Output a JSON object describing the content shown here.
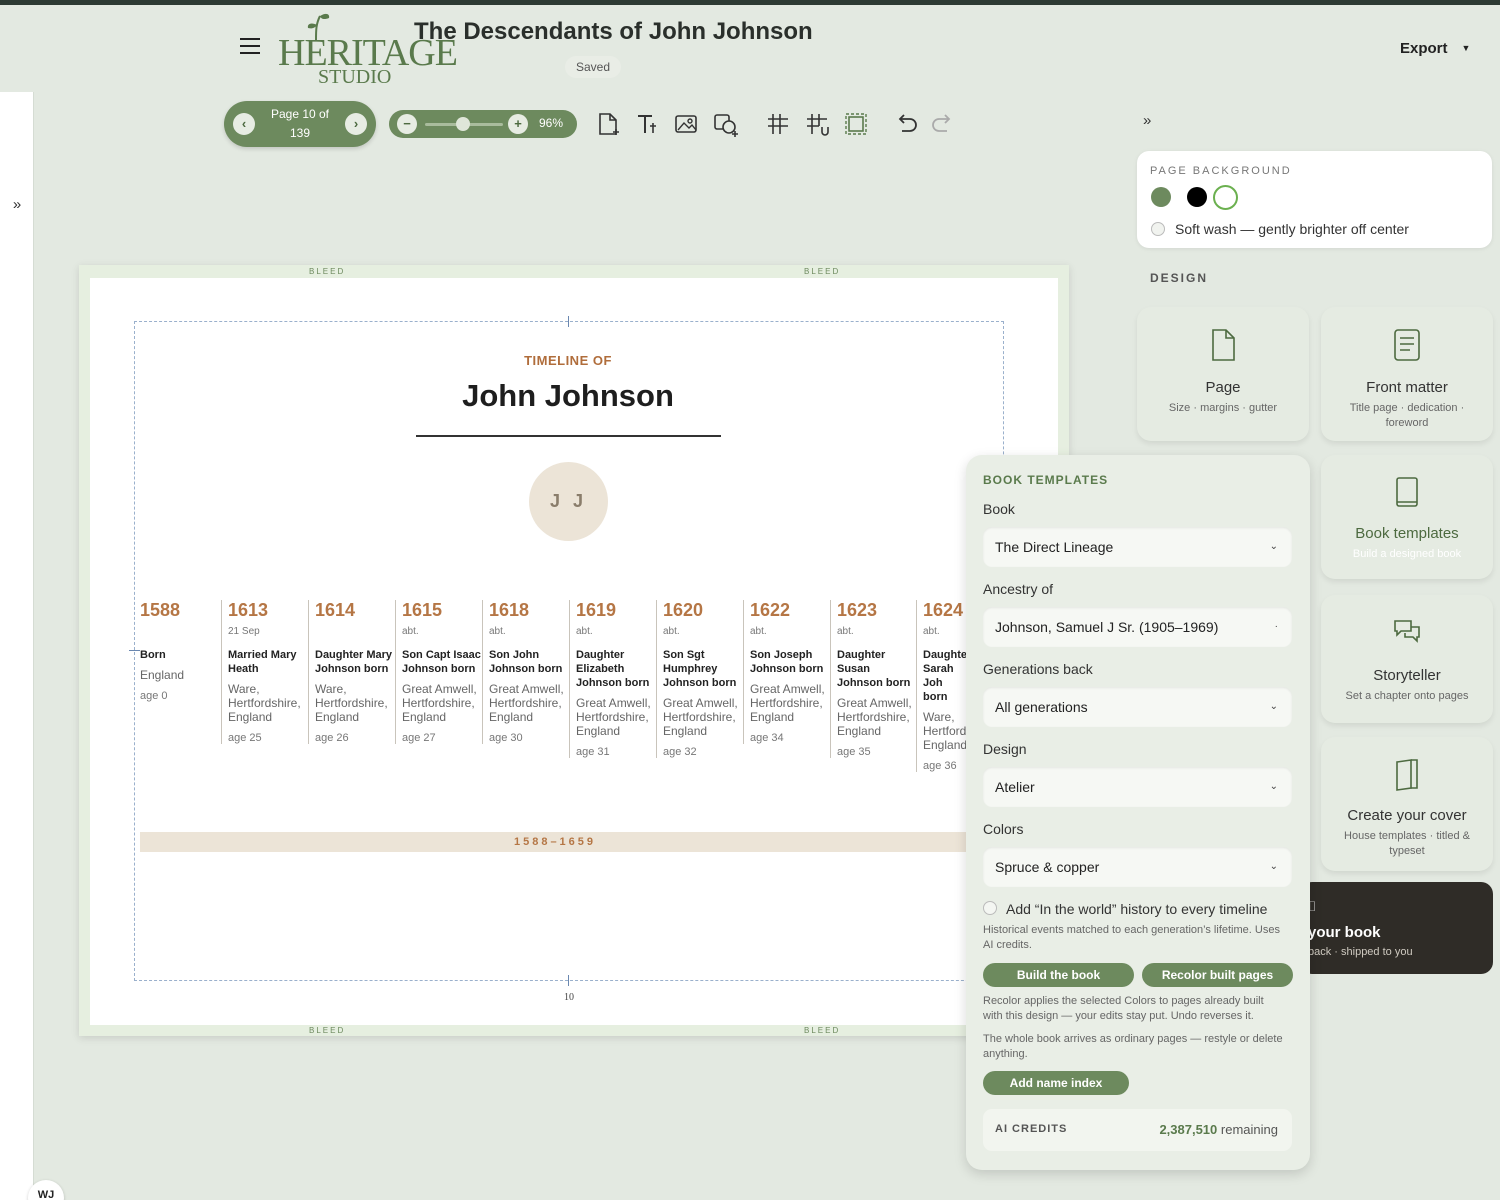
{
  "header": {
    "logo_top": "HERITAGE",
    "logo_bottom": "STUDIO",
    "title": "The Descendants of John Johnson",
    "saved": "Saved",
    "export": "Export"
  },
  "toolbar": {
    "page_indicator": "Page 10 of 139",
    "zoom": "96%",
    "zoom_level": 0.55,
    "icons": [
      "add-page-icon",
      "add-text-icon",
      "add-image-icon",
      "add-shape-icon",
      "grid-icon",
      "snap-grid-icon",
      "frame-icon",
      "undo-icon",
      "redo-icon"
    ]
  },
  "page_background": {
    "label": "PAGE BACKGROUND",
    "swatches": [
      "#6d8a5e",
      "#000000",
      "#ffffff"
    ],
    "soft_wash": "Soft wash — gently brighter off center"
  },
  "design": {
    "label": "DESIGN",
    "cards": [
      {
        "title": "Page",
        "sub": "Size · margins · gutter"
      },
      {
        "title": "Front matter",
        "sub": "Title page · dedication · foreword"
      },
      {
        "title": "Book templates",
        "sub": "Build a designed book"
      },
      {
        "title": "Storyteller",
        "sub": "Set a chapter onto pages"
      },
      {
        "title": "Create your cover",
        "sub": "House templates · titled & typeset"
      }
    ],
    "print": {
      "title": "your book",
      "sub": "back · shipped to you"
    }
  },
  "canvas": {
    "bleed": "BLEED",
    "kicker": "TIMELINE OF",
    "name": "John Johnson",
    "initials": "J J",
    "date_range": "1588–1659",
    "page_number": "10",
    "events": [
      {
        "year": "1588",
        "date": "",
        "what": "Born",
        "place": "England",
        "age": "age 0"
      },
      {
        "year": "1613",
        "date": "21 Sep",
        "what": "Married Mary Heath",
        "place": "Ware, Hertfordshire, England",
        "age": "age 25"
      },
      {
        "year": "1614",
        "date": "",
        "what": "Daughter Mary Johnson born",
        "place": "Ware, Hertfordshire, England",
        "age": "age 26"
      },
      {
        "year": "1615",
        "date": "abt.",
        "what": "Son Capt Isaac Johnson born",
        "place": "Great Amwell, Hertfordshire, England",
        "age": "age 27"
      },
      {
        "year": "1618",
        "date": "abt.",
        "what": "Son John Johnson born",
        "place": "Great Amwell, Hertfordshire, England",
        "age": "age 30"
      },
      {
        "year": "1619",
        "date": "abt.",
        "what": "Daughter Elizabeth Johnson born",
        "place": "Great Amwell, Hertfordshire, England",
        "age": "age 31"
      },
      {
        "year": "1620",
        "date": "abt.",
        "what": "Son Sgt Humphrey Johnson born",
        "place": "Great Amwell, Hertfordshire, England",
        "age": "age 32"
      },
      {
        "year": "1622",
        "date": "abt.",
        "what": "Son Joseph Johnson born",
        "place": "Great Amwell, Hertfordshire, England",
        "age": "age 34"
      },
      {
        "year": "1623",
        "date": "abt.",
        "what": "Daughter Susan Johnson born",
        "place": "Great Amwell, Hertfordshire, England",
        "age": "age 35"
      },
      {
        "year": "1624",
        "date": "abt.",
        "what": "Daughter Sarah Joh born",
        "place": "Ware, Hertford England",
        "age": "age 36"
      }
    ]
  },
  "templates": {
    "heading": "BOOK TEMPLATES",
    "book_label": "Book",
    "book_value": "The Direct Lineage",
    "ancestry_label": "Ancestry of",
    "ancestry_value": "Johnson, Samuel J Sr. (1905–1969)",
    "generations_label": "Generations back",
    "generations_value": "All generations",
    "design_label": "Design",
    "design_value": "Atelier",
    "colors_label": "Colors",
    "colors_value": "Spruce & copper",
    "history_checkbox": "Add “In the world” history to every timeline",
    "history_note": "Historical events matched to each generation’s lifetime. Uses AI credits.",
    "build_btn": "Build the book",
    "recolor_btn": "Recolor built pages",
    "recolor_note": "Recolor applies the selected Colors to pages already built with this design — your edits stay put. Undo reverses it.",
    "whole_note": "The whole book arrives as ordinary pages — restyle or delete anything.",
    "index_btn": "Add name index",
    "credits_label": "AI CREDITS",
    "credits_value": "2,387,510",
    "credits_suffix": "remaining"
  },
  "user": {
    "initials": "WJ"
  }
}
